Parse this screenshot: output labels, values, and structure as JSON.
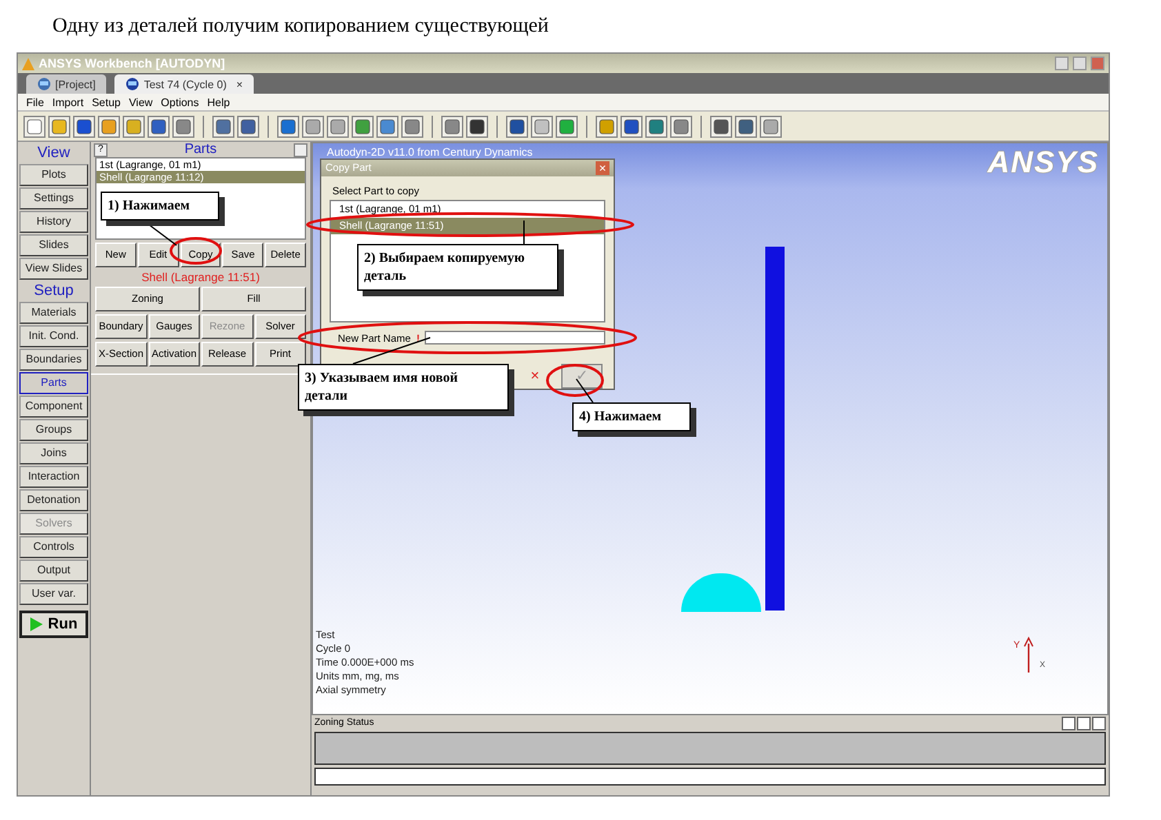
{
  "page_title": "Одну из деталей получим копированием существующей",
  "window": {
    "title": "ANSYS Workbench [AUTODYN]"
  },
  "tabs": [
    {
      "label": "[Project]",
      "selected": false
    },
    {
      "label": "Test 74 (Cycle 0)",
      "selected": true,
      "close": "×"
    }
  ],
  "menu": [
    "File",
    "Import",
    "Setup",
    "View",
    "Options",
    "Help"
  ],
  "nav": [
    {
      "kind": "header",
      "label": "View"
    },
    {
      "kind": "button",
      "label": "Plots",
      "selected": false,
      "disabled": false
    },
    {
      "kind": "button",
      "label": "Settings",
      "selected": false,
      "disabled": false
    },
    {
      "kind": "button",
      "label": "History",
      "selected": false,
      "disabled": false
    },
    {
      "kind": "button",
      "label": "Slides",
      "selected": false,
      "disabled": false
    },
    {
      "kind": "button",
      "label": "View Slides",
      "selected": false,
      "disabled": false
    },
    {
      "kind": "header",
      "label": "Setup"
    },
    {
      "kind": "button",
      "label": "Materials",
      "selected": false,
      "disabled": false
    },
    {
      "kind": "button",
      "label": "Init. Cond.",
      "selected": false,
      "disabled": false
    },
    {
      "kind": "button",
      "label": "Boundaries",
      "selected": false,
      "disabled": false
    },
    {
      "kind": "button",
      "label": "Parts",
      "selected": true,
      "disabled": false
    },
    {
      "kind": "button",
      "label": "Component",
      "selected": false,
      "disabled": false
    },
    {
      "kind": "button",
      "label": "Groups",
      "selected": false,
      "disabled": false
    },
    {
      "kind": "button",
      "label": "Joins",
      "selected": false,
      "disabled": false
    },
    {
      "kind": "button",
      "label": "Interaction",
      "selected": false,
      "disabled": false
    },
    {
      "kind": "button",
      "label": "Detonation",
      "selected": false,
      "disabled": false
    },
    {
      "kind": "button",
      "label": "Solvers",
      "selected": false,
      "disabled": true
    },
    {
      "kind": "button",
      "label": "Controls",
      "selected": false,
      "disabled": false
    },
    {
      "kind": "button",
      "label": "Output",
      "selected": false,
      "disabled": false
    },
    {
      "kind": "button",
      "label": "User var.",
      "selected": false,
      "disabled": false
    },
    {
      "kind": "run",
      "label": "Run"
    }
  ],
  "parts_panel": {
    "help": "?",
    "title": "Parts",
    "list": [
      {
        "label": "1st (Lagrange, 01 m1)",
        "selected": false
      },
      {
        "label": "Shell (Lagrange 11:12)",
        "selected": true
      }
    ],
    "actions": [
      {
        "label": "New",
        "disabled": false
      },
      {
        "label": "Edit",
        "disabled": false
      },
      {
        "label": "Copy",
        "disabled": false
      },
      {
        "label": "Save",
        "disabled": false
      },
      {
        "label": "Delete",
        "disabled": false
      }
    ],
    "current_part": "Shell (Lagrange 11:51)",
    "tools": [
      [
        {
          "label": "Zoning",
          "disabled": false
        },
        {
          "label": "Fill",
          "disabled": false
        }
      ],
      [
        {
          "label": "Boundary",
          "disabled": false
        },
        {
          "label": "Gauges",
          "disabled": false
        },
        {
          "label": "Rezone",
          "disabled": true
        },
        {
          "label": "Solver",
          "disabled": false
        }
      ],
      [
        {
          "label": "X-Section",
          "disabled": false
        },
        {
          "label": "Activation",
          "disabled": false
        },
        {
          "label": "Release",
          "disabled": false
        },
        {
          "label": "Print",
          "disabled": false
        }
      ]
    ]
  },
  "viewport": {
    "header": "Autodyn-2D v11.0 from Century Dynamics",
    "logo": "ANSYS",
    "info": [
      "Test",
      "Cycle 0",
      "Time 0.000E+000 ms",
      "Units mm, mg, ms",
      "Axial symmetry"
    ],
    "axis_labels": [
      "Y",
      "X"
    ]
  },
  "dialog": {
    "title": "Copy Part",
    "close": "×",
    "prompt": "Select Part to copy",
    "list": [
      {
        "label": "1st (Lagrange, 01 m1)",
        "selected": false
      },
      {
        "label": "Shell (Lagrange 11:51)",
        "selected": true
      }
    ],
    "name_label": "New Part Name",
    "required_mark": "!",
    "cancel": "×",
    "ok": "✓"
  },
  "callouts": [
    "1) Нажимаем",
    "2) Выбираем копируемую деталь",
    "3) Указываем имя новой детали",
    "4) Нажимаем"
  ],
  "bottom_panel": {
    "title": "Zoning Status"
  }
}
